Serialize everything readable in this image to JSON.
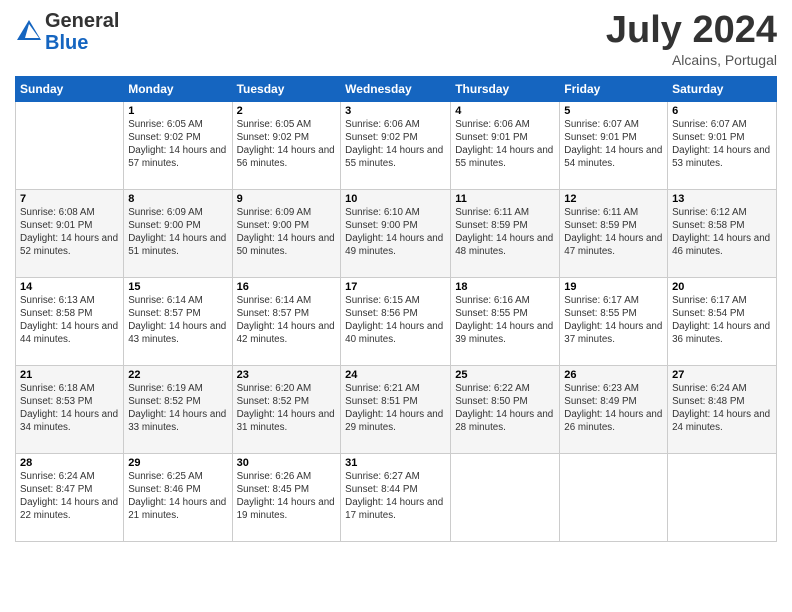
{
  "logo": {
    "general": "General",
    "blue": "Blue"
  },
  "header": {
    "month": "July 2024",
    "location": "Alcains, Portugal"
  },
  "weekdays": [
    "Sunday",
    "Monday",
    "Tuesday",
    "Wednesday",
    "Thursday",
    "Friday",
    "Saturday"
  ],
  "weeks": [
    [
      {
        "day": "",
        "sunrise": "",
        "sunset": "",
        "daylight": ""
      },
      {
        "day": "1",
        "sunrise": "Sunrise: 6:05 AM",
        "sunset": "Sunset: 9:02 PM",
        "daylight": "Daylight: 14 hours and 57 minutes."
      },
      {
        "day": "2",
        "sunrise": "Sunrise: 6:05 AM",
        "sunset": "Sunset: 9:02 PM",
        "daylight": "Daylight: 14 hours and 56 minutes."
      },
      {
        "day": "3",
        "sunrise": "Sunrise: 6:06 AM",
        "sunset": "Sunset: 9:02 PM",
        "daylight": "Daylight: 14 hours and 55 minutes."
      },
      {
        "day": "4",
        "sunrise": "Sunrise: 6:06 AM",
        "sunset": "Sunset: 9:01 PM",
        "daylight": "Daylight: 14 hours and 55 minutes."
      },
      {
        "day": "5",
        "sunrise": "Sunrise: 6:07 AM",
        "sunset": "Sunset: 9:01 PM",
        "daylight": "Daylight: 14 hours and 54 minutes."
      },
      {
        "day": "6",
        "sunrise": "Sunrise: 6:07 AM",
        "sunset": "Sunset: 9:01 PM",
        "daylight": "Daylight: 14 hours and 53 minutes."
      }
    ],
    [
      {
        "day": "7",
        "sunrise": "Sunrise: 6:08 AM",
        "sunset": "Sunset: 9:01 PM",
        "daylight": "Daylight: 14 hours and 52 minutes."
      },
      {
        "day": "8",
        "sunrise": "Sunrise: 6:09 AM",
        "sunset": "Sunset: 9:00 PM",
        "daylight": "Daylight: 14 hours and 51 minutes."
      },
      {
        "day": "9",
        "sunrise": "Sunrise: 6:09 AM",
        "sunset": "Sunset: 9:00 PM",
        "daylight": "Daylight: 14 hours and 50 minutes."
      },
      {
        "day": "10",
        "sunrise": "Sunrise: 6:10 AM",
        "sunset": "Sunset: 9:00 PM",
        "daylight": "Daylight: 14 hours and 49 minutes."
      },
      {
        "day": "11",
        "sunrise": "Sunrise: 6:11 AM",
        "sunset": "Sunset: 8:59 PM",
        "daylight": "Daylight: 14 hours and 48 minutes."
      },
      {
        "day": "12",
        "sunrise": "Sunrise: 6:11 AM",
        "sunset": "Sunset: 8:59 PM",
        "daylight": "Daylight: 14 hours and 47 minutes."
      },
      {
        "day": "13",
        "sunrise": "Sunrise: 6:12 AM",
        "sunset": "Sunset: 8:58 PM",
        "daylight": "Daylight: 14 hours and 46 minutes."
      }
    ],
    [
      {
        "day": "14",
        "sunrise": "Sunrise: 6:13 AM",
        "sunset": "Sunset: 8:58 PM",
        "daylight": "Daylight: 14 hours and 44 minutes."
      },
      {
        "day": "15",
        "sunrise": "Sunrise: 6:14 AM",
        "sunset": "Sunset: 8:57 PM",
        "daylight": "Daylight: 14 hours and 43 minutes."
      },
      {
        "day": "16",
        "sunrise": "Sunrise: 6:14 AM",
        "sunset": "Sunset: 8:57 PM",
        "daylight": "Daylight: 14 hours and 42 minutes."
      },
      {
        "day": "17",
        "sunrise": "Sunrise: 6:15 AM",
        "sunset": "Sunset: 8:56 PM",
        "daylight": "Daylight: 14 hours and 40 minutes."
      },
      {
        "day": "18",
        "sunrise": "Sunrise: 6:16 AM",
        "sunset": "Sunset: 8:55 PM",
        "daylight": "Daylight: 14 hours and 39 minutes."
      },
      {
        "day": "19",
        "sunrise": "Sunrise: 6:17 AM",
        "sunset": "Sunset: 8:55 PM",
        "daylight": "Daylight: 14 hours and 37 minutes."
      },
      {
        "day": "20",
        "sunrise": "Sunrise: 6:17 AM",
        "sunset": "Sunset: 8:54 PM",
        "daylight": "Daylight: 14 hours and 36 minutes."
      }
    ],
    [
      {
        "day": "21",
        "sunrise": "Sunrise: 6:18 AM",
        "sunset": "Sunset: 8:53 PM",
        "daylight": "Daylight: 14 hours and 34 minutes."
      },
      {
        "day": "22",
        "sunrise": "Sunrise: 6:19 AM",
        "sunset": "Sunset: 8:52 PM",
        "daylight": "Daylight: 14 hours and 33 minutes."
      },
      {
        "day": "23",
        "sunrise": "Sunrise: 6:20 AM",
        "sunset": "Sunset: 8:52 PM",
        "daylight": "Daylight: 14 hours and 31 minutes."
      },
      {
        "day": "24",
        "sunrise": "Sunrise: 6:21 AM",
        "sunset": "Sunset: 8:51 PM",
        "daylight": "Daylight: 14 hours and 29 minutes."
      },
      {
        "day": "25",
        "sunrise": "Sunrise: 6:22 AM",
        "sunset": "Sunset: 8:50 PM",
        "daylight": "Daylight: 14 hours and 28 minutes."
      },
      {
        "day": "26",
        "sunrise": "Sunrise: 6:23 AM",
        "sunset": "Sunset: 8:49 PM",
        "daylight": "Daylight: 14 hours and 26 minutes."
      },
      {
        "day": "27",
        "sunrise": "Sunrise: 6:24 AM",
        "sunset": "Sunset: 8:48 PM",
        "daylight": "Daylight: 14 hours and 24 minutes."
      }
    ],
    [
      {
        "day": "28",
        "sunrise": "Sunrise: 6:24 AM",
        "sunset": "Sunset: 8:47 PM",
        "daylight": "Daylight: 14 hours and 22 minutes."
      },
      {
        "day": "29",
        "sunrise": "Sunrise: 6:25 AM",
        "sunset": "Sunset: 8:46 PM",
        "daylight": "Daylight: 14 hours and 21 minutes."
      },
      {
        "day": "30",
        "sunrise": "Sunrise: 6:26 AM",
        "sunset": "Sunset: 8:45 PM",
        "daylight": "Daylight: 14 hours and 19 minutes."
      },
      {
        "day": "31",
        "sunrise": "Sunrise: 6:27 AM",
        "sunset": "Sunset: 8:44 PM",
        "daylight": "Daylight: 14 hours and 17 minutes."
      },
      {
        "day": "",
        "sunrise": "",
        "sunset": "",
        "daylight": ""
      },
      {
        "day": "",
        "sunrise": "",
        "sunset": "",
        "daylight": ""
      },
      {
        "day": "",
        "sunrise": "",
        "sunset": "",
        "daylight": ""
      }
    ]
  ]
}
